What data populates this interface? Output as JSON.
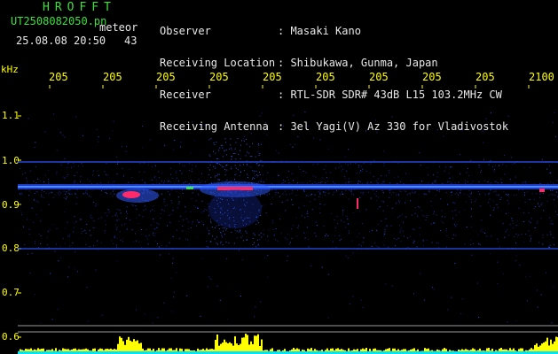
{
  "header": {
    "logo": "HROFFT",
    "file_name": "UT2508082050.pn",
    "meteor_tag": "meteor",
    "datetime": "25.08.08 20:50",
    "count": "43",
    "info": [
      {
        "label": "Observer",
        "value": ": Masaki Kano"
      },
      {
        "label": "Receiving Location",
        "value": ": Shibukawa, Gunma, Japan"
      },
      {
        "label": "Receiver",
        "value": ": RTL-SDR SDR# 43dB L15 103.2MHz CW"
      },
      {
        "label": "Receiving Antenna",
        "value": ": 3el Yagi(V) Az 330 for Vladivostok"
      }
    ]
  },
  "axis": {
    "y_unit": "kHz",
    "x_ticks": [
      "205",
      "205",
      "205",
      "205",
      "205",
      "205",
      "205",
      "205",
      "205",
      "2100"
    ],
    "y_ticks": [
      "1.1",
      "1.0",
      "0.9",
      "0.8",
      "0.7",
      "0.6"
    ]
  },
  "colors": {
    "background": "#000000",
    "text_green": "#3ce03c",
    "text_white": "#e8e8e8",
    "axis_yellow": "#ffff00",
    "signal_blue": "#2a5cff",
    "signal_hot": "#ff2a6a",
    "level_yellow": "#ffff00",
    "level_cyan": "#00e5ff"
  }
}
